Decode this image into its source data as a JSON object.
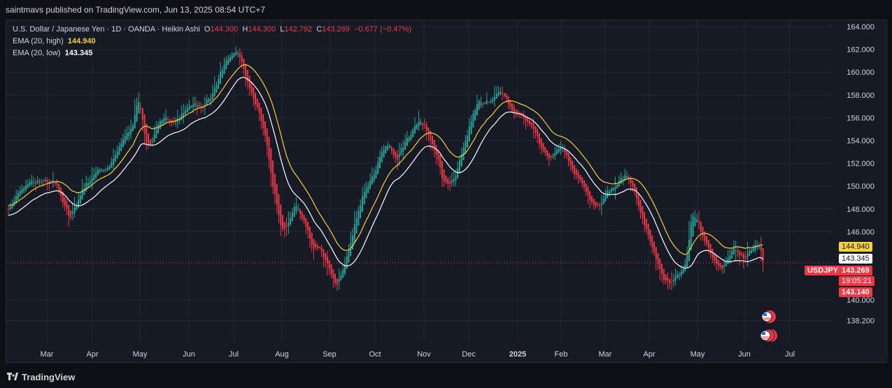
{
  "publisher": "saintmavs published on TradingView.com, Jun 13, 2025 08:54 UTC+7",
  "legend": {
    "symbol": "U.S. Dollar / Japanese Yen · 1D · OANDA · Heikin Ashi",
    "o_label": "O",
    "o": "144.300",
    "h_label": "H",
    "h": "144.300",
    "l_label": "L",
    "l": "142.792",
    "c_label": "C",
    "c": "143.269",
    "change": "−0.677 (−0.47%)",
    "ema_high_label": "EMA (20, high)",
    "ema_high_value": "144.940",
    "ema_low_label": "EMA (20, low)",
    "ema_low_value": "143.345"
  },
  "price_badges": {
    "ema_high": "144.940",
    "ema_low": "143.345",
    "symbol": "USDJPY",
    "last": "143.269",
    "countdown": "19:05:21",
    "low_marker": "143.140"
  },
  "footer": {
    "brand": "TradingView"
  },
  "colors": {
    "up": "#26a69a",
    "down": "#f23645",
    "ema_high": "#f7d038",
    "ema_low": "#ffffff",
    "background": "#161a25",
    "grid": "#232734"
  },
  "chart_data": {
    "type": "candlestick",
    "style": "Heikin Ashi",
    "interval": "1D",
    "y_ticks": [
      "164.000",
      "162.000",
      "160.000",
      "158.000",
      "156.000",
      "154.000",
      "152.000",
      "150.000",
      "148.000",
      "146.000",
      "140.000",
      "138.200"
    ],
    "ylim": [
      137.8,
      164.5
    ],
    "x_labels": [
      "Mar",
      "Apr",
      "May",
      "Jun",
      "Jul",
      "Aug",
      "Sep",
      "Oct",
      "Nov",
      "Dec",
      "2025",
      "Feb",
      "Mar",
      "Apr",
      "May",
      "Jun",
      "Jul"
    ],
    "grid": true,
    "price_path": [
      [
        0,
        148.0
      ],
      [
        5,
        149.5
      ],
      [
        10,
        150.3
      ],
      [
        18,
        150.6
      ],
      [
        24,
        150.2
      ],
      [
        28,
        148.5
      ],
      [
        31,
        147.2
      ],
      [
        34,
        148.2
      ],
      [
        38,
        149.8
      ],
      [
        42,
        150.6
      ],
      [
        46,
        151.5
      ],
      [
        50,
        151.3
      ],
      [
        55,
        153.0
      ],
      [
        60,
        154.5
      ],
      [
        64,
        155.5
      ],
      [
        66,
        157.5
      ],
      [
        68,
        156.5
      ],
      [
        70,
        154.0
      ],
      [
        73,
        153.6
      ],
      [
        77,
        155.5
      ],
      [
        80,
        156.0
      ],
      [
        85,
        155.5
      ],
      [
        90,
        156.6
      ],
      [
        94,
        157.2
      ],
      [
        97,
        156.9
      ],
      [
        101,
        157.3
      ],
      [
        105,
        158.2
      ],
      [
        109,
        160.0
      ],
      [
        112,
        161.2
      ],
      [
        115,
        161.8
      ],
      [
        118,
        161.5
      ],
      [
        120,
        160.5
      ],
      [
        123,
        159.0
      ],
      [
        126,
        157.6
      ],
      [
        129,
        156.2
      ],
      [
        132,
        154.3
      ],
      [
        135,
        150.5
      ],
      [
        138,
        148.0
      ],
      [
        140,
        146.2
      ],
      [
        143,
        146.4
      ],
      [
        147,
        148.5
      ],
      [
        150,
        147.4
      ],
      [
        153,
        146.5
      ],
      [
        155,
        145.0
      ],
      [
        158,
        144.4
      ],
      [
        160,
        144.5
      ],
      [
        162,
        143.8
      ],
      [
        165,
        142.5
      ],
      [
        168,
        141.2
      ],
      [
        170,
        141.8
      ],
      [
        172,
        143.0
      ],
      [
        175,
        144.5
      ],
      [
        178,
        146.8
      ],
      [
        181,
        148.8
      ],
      [
        184,
        150.0
      ],
      [
        187,
        150.8
      ],
      [
        190,
        152.2
      ],
      [
        193,
        153.6
      ],
      [
        196,
        153.4
      ],
      [
        199,
        152.3
      ],
      [
        202,
        153.5
      ],
      [
        205,
        154.2
      ],
      [
        208,
        155.2
      ],
      [
        211,
        155.7
      ],
      [
        214,
        155.1
      ],
      [
        217,
        154.0
      ],
      [
        220,
        152.5
      ],
      [
        223,
        150.7
      ],
      [
        226,
        150.1
      ],
      [
        229,
        150.8
      ],
      [
        232,
        152.6
      ],
      [
        235,
        154.2
      ],
      [
        238,
        156.2
      ],
      [
        241,
        157.4
      ],
      [
        244,
        157.3
      ],
      [
        247,
        157.4
      ],
      [
        250,
        157.9
      ],
      [
        253,
        158.2
      ],
      [
        256,
        157.4
      ],
      [
        259,
        156.6
      ],
      [
        262,
        156.2
      ],
      [
        265,
        156.0
      ],
      [
        268,
        155.4
      ],
      [
        271,
        154.5
      ],
      [
        274,
        153.2
      ],
      [
        277,
        152.4
      ],
      [
        280,
        152.8
      ],
      [
        283,
        153.5
      ],
      [
        286,
        152.8
      ],
      [
        289,
        151.7
      ],
      [
        292,
        150.8
      ],
      [
        295,
        150.0
      ],
      [
        298,
        149.0
      ],
      [
        301,
        148.2
      ],
      [
        304,
        148.6
      ],
      [
        307,
        149.3
      ],
      [
        310,
        149.8
      ],
      [
        313,
        150.3
      ],
      [
        316,
        150.9
      ],
      [
        319,
        150.6
      ],
      [
        322,
        149.2
      ],
      [
        325,
        147.5
      ],
      [
        328,
        146.0
      ],
      [
        331,
        144.5
      ],
      [
        334,
        142.8
      ],
      [
        337,
        141.8
      ],
      [
        340,
        141.3
      ],
      [
        343,
        142.2
      ],
      [
        346,
        142.6
      ],
      [
        349,
        144.0
      ],
      [
        350,
        146.6
      ],
      [
        352,
        147.6
      ],
      [
        354,
        146.8
      ],
      [
        357,
        145.5
      ],
      [
        360,
        144.5
      ],
      [
        363,
        143.2
      ],
      [
        366,
        142.8
      ],
      [
        369,
        143.5
      ],
      [
        372,
        144.6
      ],
      [
        375,
        144.3
      ],
      [
        378,
        143.5
      ],
      [
        381,
        144.3
      ],
      [
        384,
        145.0
      ],
      [
        386,
        144.6
      ],
      [
        388,
        143.269
      ]
    ]
  }
}
